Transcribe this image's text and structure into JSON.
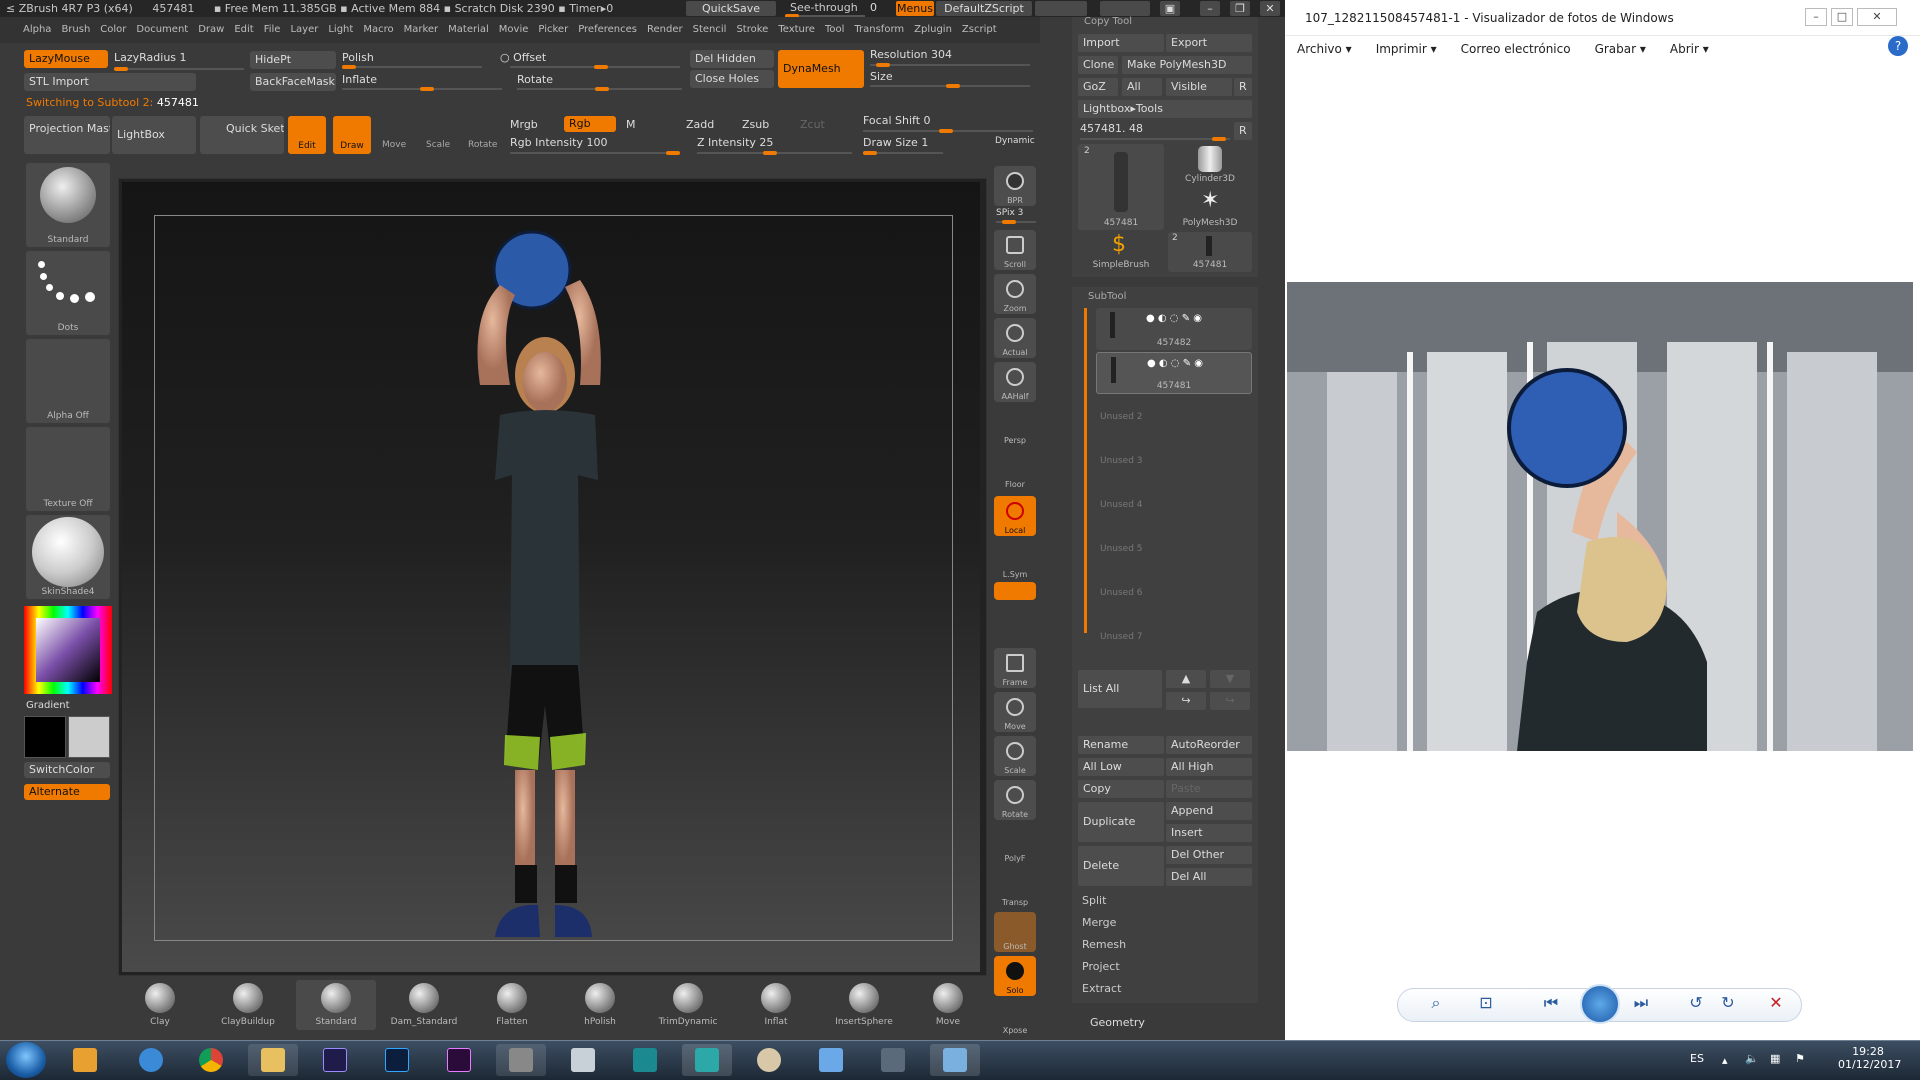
{
  "zbrush": {
    "title_left": "ZBrush 4R7 P3 (x64)",
    "title_id": "457481",
    "title_mem": "▪ Free Mem 11.385GB ▪ Active Mem 884 ▪ Scratch Disk 2390 ▪ Timer▸0",
    "quicksave": "QuickSave",
    "seethrough": "See-through",
    "seethrough_val": "0",
    "menus": "Menus",
    "defaultzscript": "DefaultZScript",
    "menu_items": [
      "Alpha",
      "Brush",
      "Color",
      "Document",
      "Draw",
      "Edit",
      "File",
      "Layer",
      "Light",
      "Macro",
      "Marker",
      "Material",
      "Movie",
      "Picker",
      "Preferences",
      "Render",
      "Stencil",
      "Stroke",
      "Texture",
      "Tool",
      "Transform",
      "Zplugin",
      "Zscript"
    ],
    "top": {
      "lazymouse": "LazyMouse",
      "lazyradius": "LazyRadius",
      "lazyradius_val": "1",
      "stl_import": "STL Import",
      "switching": "Switching to Subtool 2:",
      "switching_val": "457481",
      "hidept": "HidePt",
      "backfacemask": "BackFaceMask",
      "polish": "Polish",
      "inflate": "Inflate",
      "offset": "Offset",
      "rotate": "Rotate",
      "del_hidden": "Del Hidden",
      "close_holes": "Close Holes",
      "dynamesh": "DynaMesh",
      "resolution": "Resolution",
      "resolution_val": "304",
      "size": "Size",
      "projection_master": "Projection Master",
      "lightbox": "LightBox",
      "quick_sketch": "Quick Sketch",
      "edit": "Edit",
      "draw": "Draw",
      "move": "Move",
      "scale": "Scale",
      "rotate_btn": "Rotate",
      "mrgb": "Mrgb",
      "rgb": "Rgb",
      "m": "M",
      "zadd": "Zadd",
      "zsub": "Zsub",
      "zcut": "Zcut",
      "rgb_intensity": "Rgb Intensity",
      "rgb_intensity_val": "100",
      "z_intensity": "Z Intensity",
      "z_intensity_val": "25",
      "focal_shift": "Focal Shift",
      "focal_shift_val": "0",
      "draw_size": "Draw Size",
      "draw_size_val": "1",
      "dynamic": "Dynamic"
    },
    "left_shelf": {
      "brush_label": "Standard",
      "stroke_label": "Dots",
      "alpha_label": "Alpha Off",
      "texture_label": "Texture Off",
      "material_label": "SkinShade4",
      "gradient": "Gradient",
      "switchcolor": "SwitchColor",
      "alternate": "Alternate"
    },
    "right_tools": [
      "BPR",
      "SPix 3",
      "Scroll",
      "Zoom",
      "Actual",
      "AAHalf",
      "Persp",
      "Floor",
      "Local",
      "L.Sym",
      "Frame",
      "Move",
      "Scale",
      "Rotate",
      "PolyF",
      "Transp",
      "Ghost",
      "Solo",
      "Xpose"
    ],
    "spix_val": "3",
    "bottom_brushes": [
      "Clay",
      "ClayBuildup",
      "Standard",
      "Dam_Standard",
      "Flatten",
      "hPolish",
      "TrimDynamic",
      "Inflat",
      "InsertSphere",
      "Move"
    ],
    "tool_panel": {
      "copy_tool": "Copy Tool",
      "import": "Import",
      "export": "Export",
      "clone": "Clone",
      "make_polymesh": "Make PolyMesh3D",
      "goz": "GoZ",
      "all": "All",
      "visible": "Visible",
      "r": "R",
      "lightbox_tools": "Lightbox▸Tools",
      "tool_value": "457481. 48",
      "thumbs": [
        {
          "label": "457481",
          "badge": "2"
        },
        {
          "label": "Cylinder3D",
          "badge": ""
        },
        {
          "label": "PolyMesh3D",
          "badge": ""
        },
        {
          "label": "SimpleBrush",
          "badge": ""
        },
        {
          "label": "457481",
          "badge": "2"
        }
      ]
    },
    "subtool": {
      "header": "SubTool",
      "items": [
        "457482",
        "457481"
      ],
      "unused": [
        "Unused 2",
        "Unused 3",
        "Unused 4",
        "Unused 5",
        "Unused 6",
        "Unused 7"
      ],
      "list_all": "List All",
      "rename": "Rename",
      "autoreorder": "AutoReorder",
      "all_low": "All Low",
      "all_high": "All High",
      "copy": "Copy",
      "paste": "Paste",
      "duplicate": "Duplicate",
      "append": "Append",
      "insert": "Insert",
      "delete": "Delete",
      "del_other": "Del Other",
      "del_all": "Del All",
      "split": "Split",
      "merge": "Merge",
      "remesh": "Remesh",
      "project": "Project",
      "extract": "Extract",
      "geometry": "Geometry"
    }
  },
  "viewer": {
    "title": "107_128211508457481-1 - Visualizador de fotos de Windows",
    "menu": [
      "Archivo",
      "Imprimir",
      "Correo electrónico",
      "Grabar",
      "Abrir"
    ],
    "menu_dropdown": [
      true,
      true,
      false,
      true,
      true
    ]
  },
  "taskbar": {
    "lang": "ES",
    "time": "19:28",
    "date": "01/12/2017"
  },
  "colors": {
    "accent": "#f07a00",
    "panel": "#3a3a3a",
    "taskbar": "#1c2834"
  }
}
